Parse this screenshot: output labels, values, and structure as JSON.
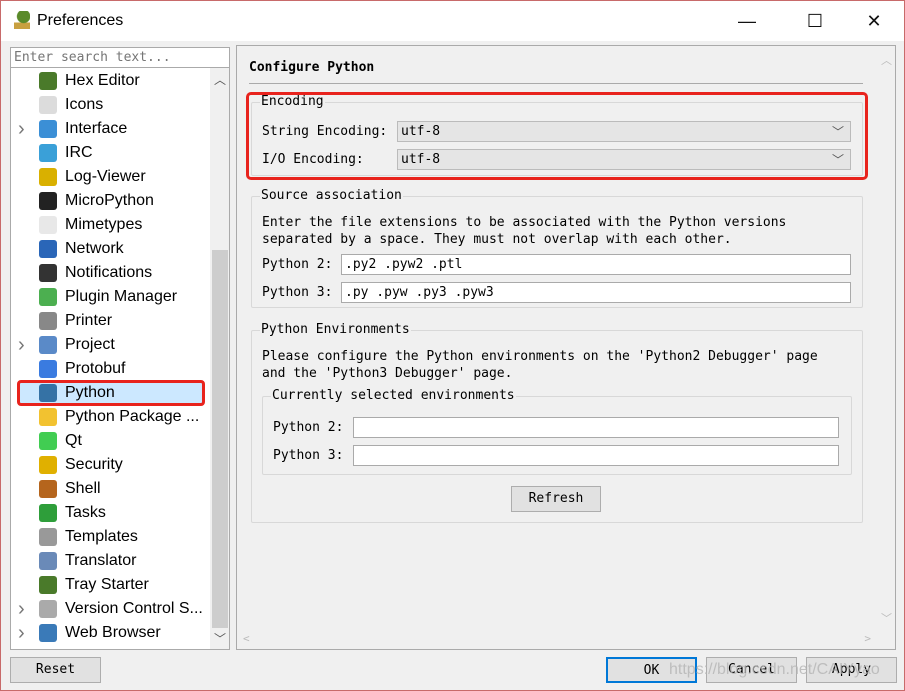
{
  "window": {
    "title": "Preferences",
    "minimize": "—",
    "maximize": "☐",
    "close": "✕"
  },
  "sidebar": {
    "search_placeholder": "Enter search text...",
    "items": [
      {
        "label": "Hex Editor",
        "expandable": false,
        "color": "#4a7a2a"
      },
      {
        "label": "Icons",
        "expandable": false,
        "color": "#dcdcdc"
      },
      {
        "label": "Interface",
        "expandable": true,
        "color": "#3b8fd6"
      },
      {
        "label": "IRC",
        "expandable": false,
        "color": "#3aa0d8"
      },
      {
        "label": "Log-Viewer",
        "expandable": false,
        "color": "#d9b000"
      },
      {
        "label": "MicroPython",
        "expandable": false,
        "color": "#222222"
      },
      {
        "label": "Mimetypes",
        "expandable": false,
        "color": "#e8e8e8"
      },
      {
        "label": "Network",
        "expandable": false,
        "color": "#2a66b8"
      },
      {
        "label": "Notifications",
        "expandable": false,
        "color": "#333333"
      },
      {
        "label": "Plugin Manager",
        "expandable": false,
        "color": "#4caf50"
      },
      {
        "label": "Printer",
        "expandable": false,
        "color": "#888888"
      },
      {
        "label": "Project",
        "expandable": true,
        "color": "#5a8ac8"
      },
      {
        "label": "Protobuf",
        "expandable": false,
        "color": "#3a7be0"
      },
      {
        "label": "Python",
        "expandable": false,
        "color": "#3572a5",
        "selected": true
      },
      {
        "label": "Python Package ...",
        "expandable": false,
        "color": "#f2c230"
      },
      {
        "label": "Qt",
        "expandable": false,
        "color": "#41cd52"
      },
      {
        "label": "Security",
        "expandable": false,
        "color": "#e0b000"
      },
      {
        "label": "Shell",
        "expandable": false,
        "color": "#b5651d"
      },
      {
        "label": "Tasks",
        "expandable": false,
        "color": "#2e9e3a"
      },
      {
        "label": "Templates",
        "expandable": false,
        "color": "#999999"
      },
      {
        "label": "Translator",
        "expandable": false,
        "color": "#6a8ab8"
      },
      {
        "label": "Tray Starter",
        "expandable": false,
        "color": "#4a7a2a"
      },
      {
        "label": "Version Control S...",
        "expandable": true,
        "color": "#aaaaaa"
      },
      {
        "label": "Web Browser",
        "expandable": true,
        "color": "#3a7ab8"
      }
    ]
  },
  "main": {
    "title": "Configure Python",
    "encoding": {
      "label": "Encoding",
      "string_label": "String Encoding:",
      "string_value": "utf-8",
      "io_label": "I/O Encoding:",
      "io_value": "utf-8"
    },
    "source": {
      "label": "Source association",
      "desc1": "Enter the file extensions to be associated with the Python versions",
      "desc2": "separated by a space. They must not overlap with each other.",
      "py2_label": "Python 2:",
      "py2_value": ".py2 .pyw2 .ptl",
      "py3_label": "Python 3:",
      "py3_value": ".py .pyw .py3 .pyw3"
    },
    "envs": {
      "label": "Python Environments",
      "desc1": "Please configure the Python environments on the 'Python2 Debugger' page",
      "desc2": "and the 'Python3 Debugger' page.",
      "current_label": "Currently selected environments",
      "py2_label": "Python 2:",
      "py2_value": "",
      "py3_label": "Python 3:",
      "py3_value": "",
      "refresh": "Refresh"
    }
  },
  "footer": {
    "reset": "Reset",
    "ok": "OK",
    "cancel": "Cancel",
    "apply": "Apply"
  },
  "watermark": "https://blog.csdn.net/CAIYyao"
}
